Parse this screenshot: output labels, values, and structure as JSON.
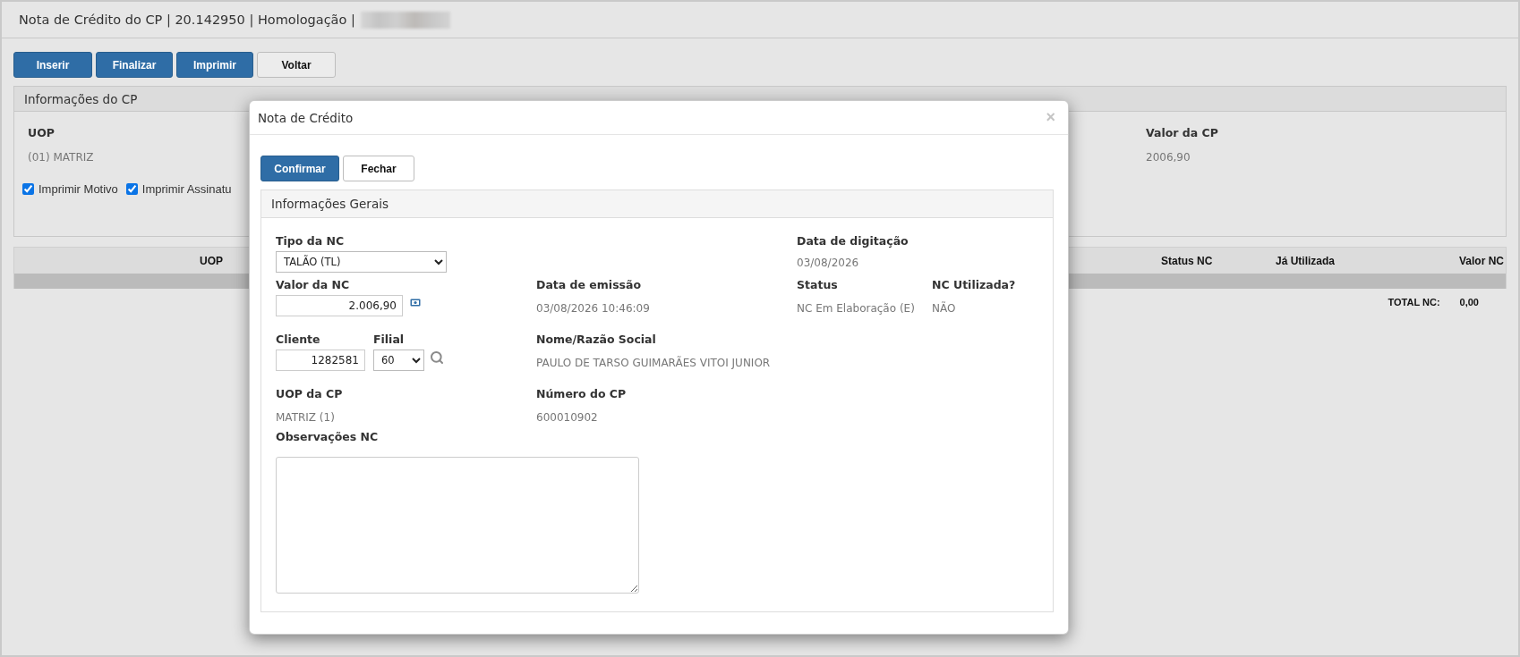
{
  "page": {
    "title": "Nota de Crédito do CP | 20.142950 | Homologação |",
    "title_redacted": true
  },
  "toolbar": [
    {
      "label": "Inserir",
      "kind": "primary"
    },
    {
      "label": "Finalizar",
      "kind": "primary"
    },
    {
      "label": "Imprimir",
      "kind": "primary"
    },
    {
      "label": "Voltar",
      "kind": "default"
    }
  ],
  "info_panel": {
    "title": "Informações do CP",
    "fields": [
      {
        "label": "UOP",
        "value": "(01) MATRIZ"
      },
      {
        "label": "Valor da CP",
        "value": "2006,90"
      }
    ],
    "checkboxes": [
      {
        "label": "Imprimir Motivo",
        "checked": true
      },
      {
        "label": "Imprimir Assinatu",
        "checked": true
      }
    ]
  },
  "table": {
    "columns": [
      "UOP",
      "Status NC",
      "Já Utilizada",
      "Valor NC"
    ],
    "total_label": "TOTAL NC:",
    "total_value": "0,00"
  },
  "modal": {
    "title": "Nota de Crédito",
    "close": "×",
    "buttons": [
      {
        "label": "Confirmar",
        "kind": "primary"
      },
      {
        "label": "Fechar",
        "kind": "default"
      }
    ],
    "section": {
      "title": "Informações Gerais",
      "tipo_nc": {
        "label": "Tipo da NC",
        "value": "TALÃO (TL)"
      },
      "data_digitacao": {
        "label": "Data de digitação",
        "value": "03/08/2026"
      },
      "valor_nc": {
        "label": "Valor da NC",
        "value": "2.006,90"
      },
      "data_emissao": {
        "label": "Data de emissão",
        "value": "03/08/2026 10:46:09"
      },
      "status": {
        "label": "Status",
        "value": "NC Em Elaboração (E)"
      },
      "nc_utilizada": {
        "label": "NC Utilizada?",
        "value": "NÃO"
      },
      "cliente": {
        "label": "Cliente",
        "value": "1282581"
      },
      "filial": {
        "label": "Filial",
        "value": "60"
      },
      "nome": {
        "label": "Nome/Razão Social",
        "value": "PAULO DE TARSO GUIMARÃES VITOI JUNIOR"
      },
      "uop_cp": {
        "label": "UOP da CP",
        "value": "MATRIZ (1)"
      },
      "numero_cp": {
        "label": "Número do CP",
        "value": "600010902"
      },
      "observacoes": {
        "label": "Observações NC"
      }
    }
  }
}
